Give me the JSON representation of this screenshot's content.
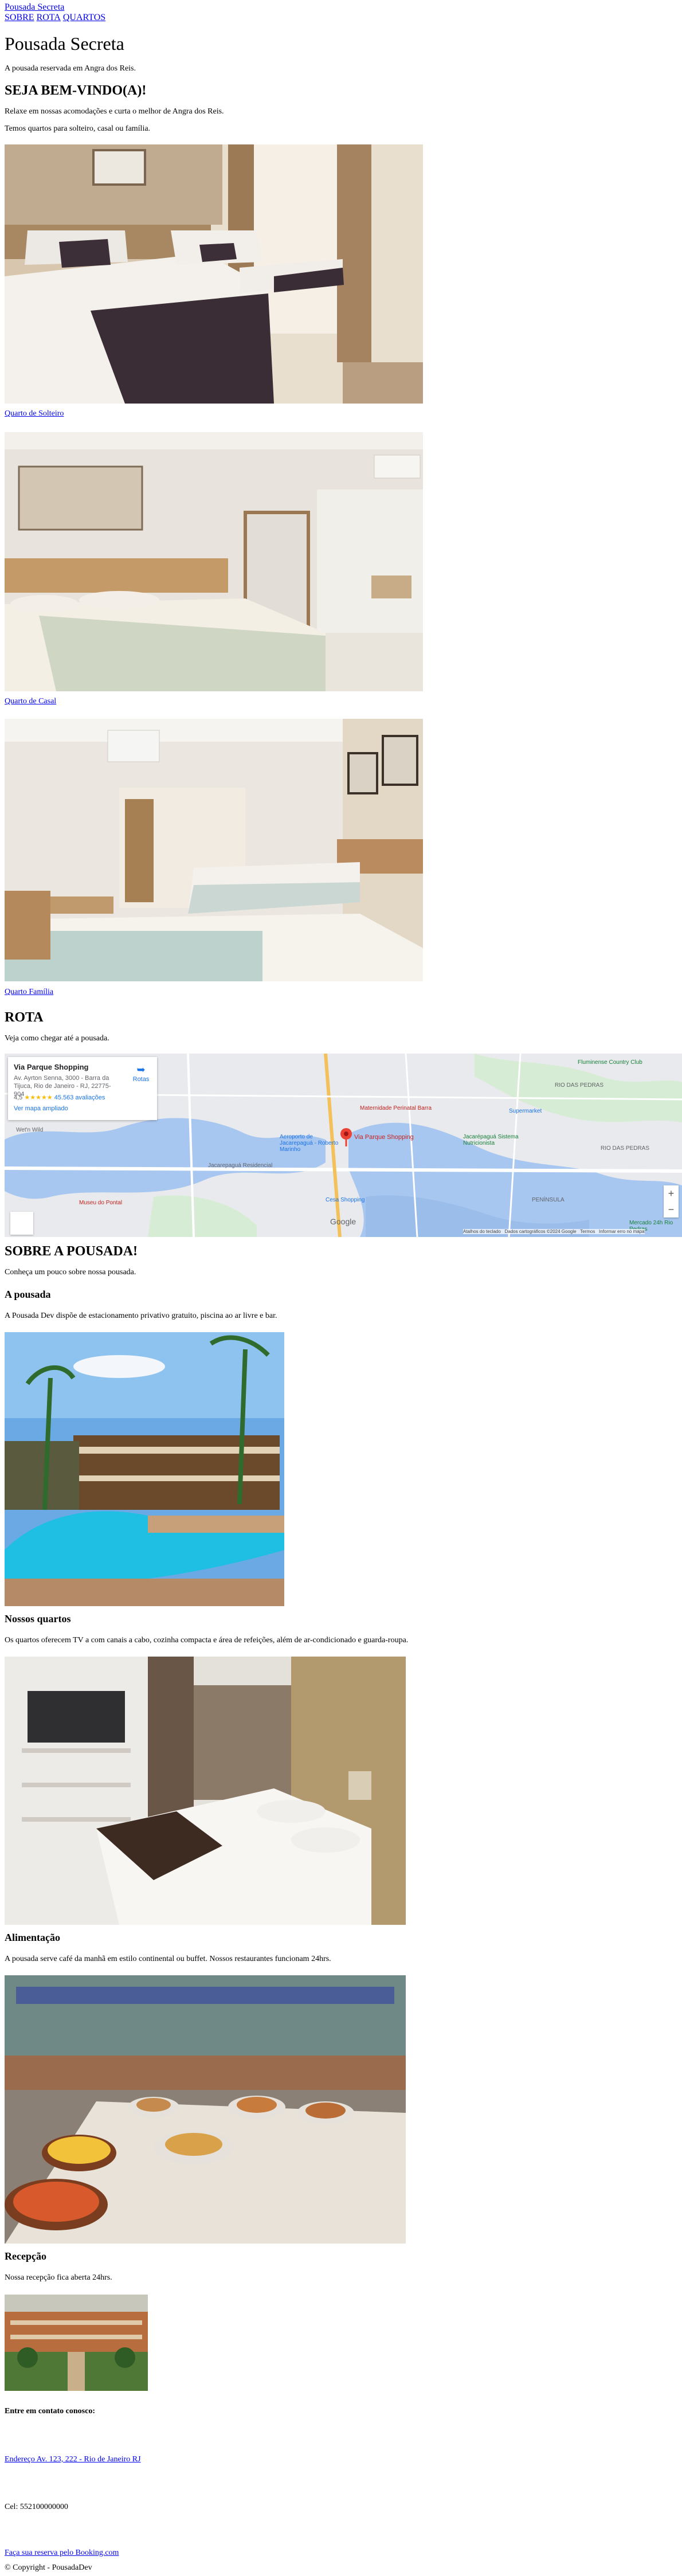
{
  "header": {
    "logo": "Pousada Secreta",
    "nav": [
      "SOBRE",
      "ROTA",
      "QUARTOS"
    ]
  },
  "hero": {
    "title": "Pousada Secreta",
    "subtitle": "A pousada reservada em Angra dos Reis."
  },
  "welcome": {
    "title": "SEJA BEM-VINDO(A)!",
    "text1": "Relaxe em nossas acomodações e curta o melhor de Angra dos Reis.",
    "text2": "Temos quartos para solteiro, casal ou família."
  },
  "rooms": [
    {
      "label": "Quarto de Solteiro"
    },
    {
      "label": "Quarto de Casal"
    },
    {
      "label": "Quarto Família"
    }
  ],
  "route": {
    "title": "ROTA",
    "text": "Veja como chegar até a pousada.",
    "map": {
      "place_name": "Via Parque Shopping",
      "address": "Av. Ayrton Senna, 3000 - Barra da Tijuca, Rio de Janeiro - RJ, 22775-904",
      "rating": "4,5",
      "reviews": "45.563 avaliações",
      "view_larger": "Ver mapa ampliado",
      "directions": "Rotas",
      "pin_label": "Via Parque Shopping",
      "labels": [
        "Fluminense Country Club",
        "RIO DAS PEDRAS",
        "Supermarket",
        "Maternidade Perinatal Barra",
        "Aeroporto de Jacarepaguá - Roberto Marinho",
        "Jacarepaguá Residencial",
        "Museu do Pontal",
        "Wet'n Wild",
        "Cesa Shopping",
        "PENÍNSULA",
        "RIO DAS PEDRAS",
        "Jacarépaguá Sistema Nutricionista",
        "Mercado 24h Rio Pedras",
        "Google"
      ],
      "zoom_in": "+",
      "zoom_out": "−",
      "footer": [
        "Atalhos do teclado",
        "Dados cartográficos ©2024 Google",
        "Termos",
        "Informar erro no mapa"
      ]
    }
  },
  "about": {
    "title": "SOBRE A POUSADA!",
    "text": "Conheça um pouco sobre nossa pousada.",
    "sections": [
      {
        "title": "A pousada",
        "text": "A Pousada Dev dispõe de estacionamento privativo gratuito, piscina ao ar livre e bar."
      },
      {
        "title": "Nossos quartos",
        "text": "Os quartos oferecem TV a com canais a cabo, cozinha compacta e área de refeições, além de ar-condicionado e guarda-roupa."
      },
      {
        "title": "Alimentação",
        "text": "A pousada serve café da manhã em estilo continental ou buffet. Nossos restaurantes funcionam 24hrs."
      },
      {
        "title": "Recepção",
        "text": "Nossa recepção fica aberta 24hrs."
      }
    ]
  },
  "contact": {
    "title": "Entre em contato conosco:",
    "address": "Endereço Av. 123, 222 - Rio de Janeiro RJ",
    "phone": "Cel: 552100000000",
    "booking": "Faça sua reserva pelo Booking.com",
    "copyright": "© Copyright - PousadaDev"
  }
}
